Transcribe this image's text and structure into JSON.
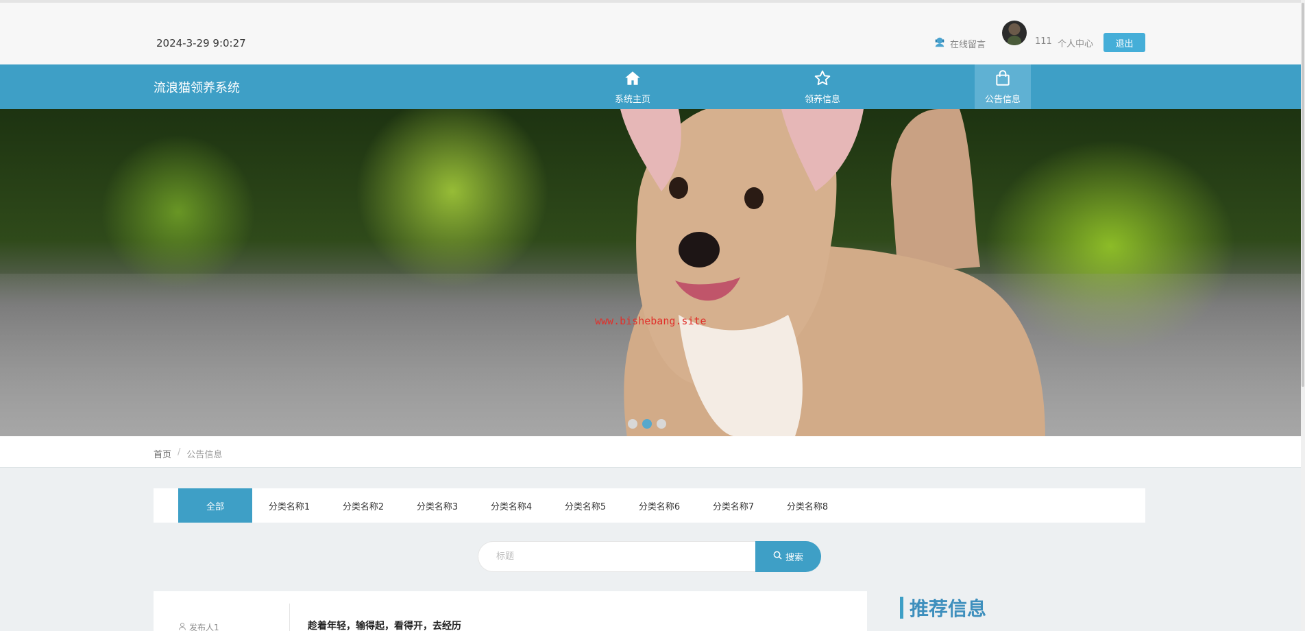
{
  "header": {
    "datetime": "2024-3-29 9:0:27",
    "message_link": "在线留言",
    "username": "111",
    "center_link": "个人中心",
    "logout_label": "退出"
  },
  "nav": {
    "brand": "流浪猫领养系统",
    "items": [
      {
        "label": "系统主页",
        "icon": "home-icon"
      },
      {
        "label": "领养信息",
        "icon": "star-icon"
      },
      {
        "label": "公告信息",
        "icon": "shopping-bag-icon",
        "active": true
      }
    ]
  },
  "banner": {
    "watermark": "www.bishebang.site",
    "slide_count": 3,
    "active_slide": 2
  },
  "breadcrumb": {
    "home": "首页",
    "separator": "/",
    "current": "公告信息"
  },
  "categories": [
    {
      "label": "全部",
      "active": true
    },
    {
      "label": "分类名称1"
    },
    {
      "label": "分类名称2"
    },
    {
      "label": "分类名称3"
    },
    {
      "label": "分类名称4"
    },
    {
      "label": "分类名称5"
    },
    {
      "label": "分类名称6"
    },
    {
      "label": "分类名称7"
    },
    {
      "label": "分类名称8"
    }
  ],
  "search": {
    "placeholder": "标题",
    "button_label": "搜索"
  },
  "list": {
    "items": [
      {
        "publisher": "发布人1",
        "title": "趁着年轻，输得起，看得开，去经历"
      }
    ]
  },
  "recommend": {
    "title": "推荐信息"
  },
  "colors": {
    "primary": "#3e9fc6",
    "logout": "#45aed8",
    "watermark": "#e0302a"
  }
}
